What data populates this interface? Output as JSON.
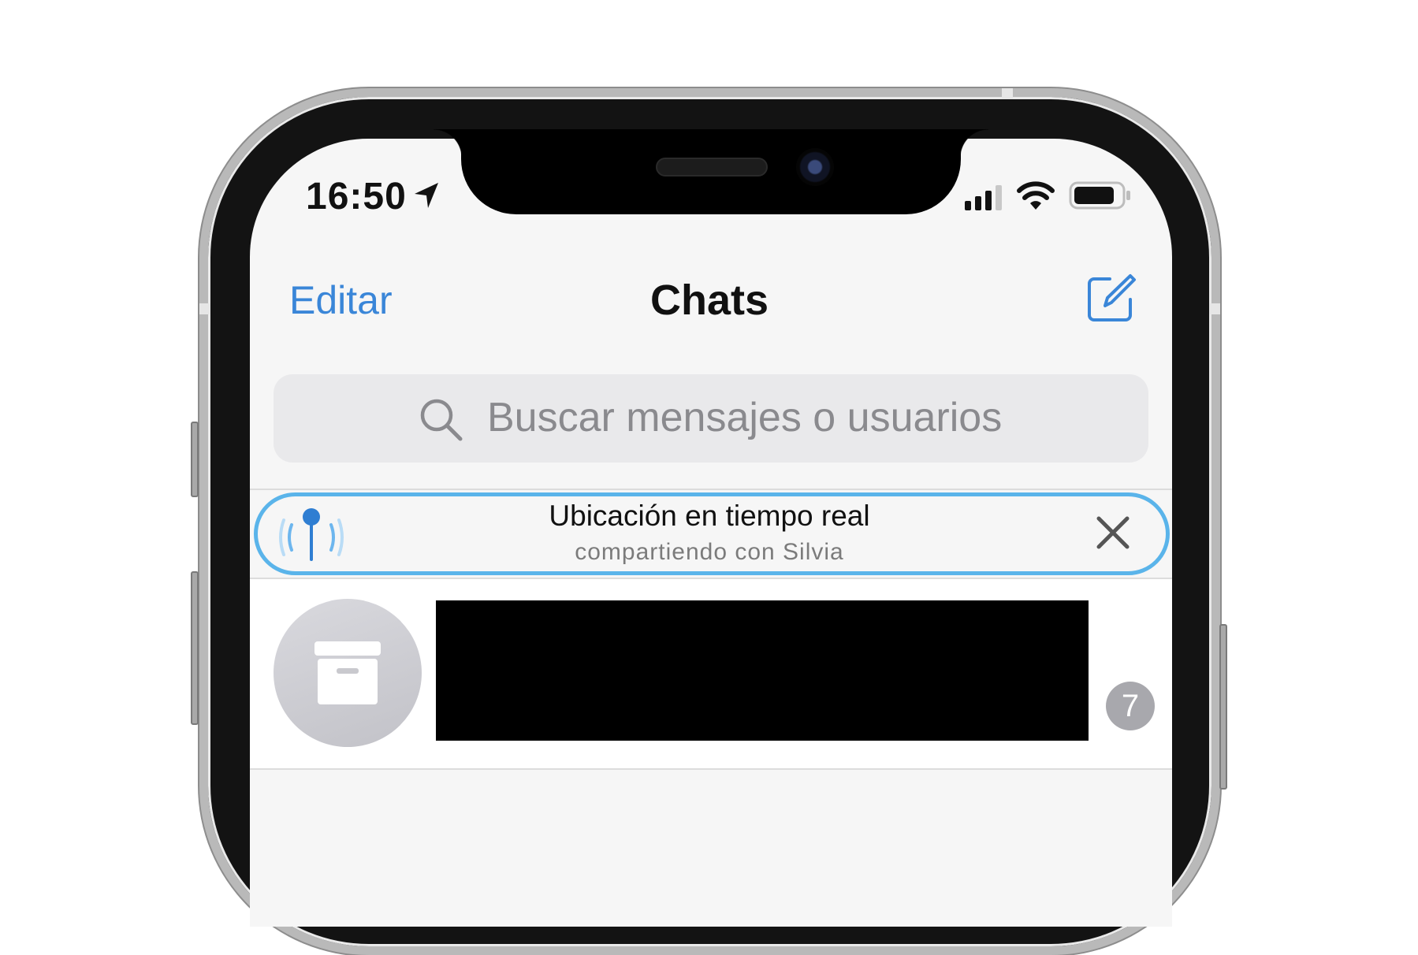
{
  "status_bar": {
    "time": "16:50",
    "location_icon": "location-arrow-icon",
    "signal_icon": "cellular-signal-icon",
    "wifi_icon": "wifi-icon",
    "battery_icon": "battery-icon"
  },
  "nav": {
    "edit_label": "Editar",
    "title": "Chats",
    "compose_icon": "compose-icon"
  },
  "search": {
    "placeholder": "Buscar mensajes o usuarios"
  },
  "live_location": {
    "title": "Ubicación en tiempo real",
    "subtitle": "compartiendo con Silvia"
  },
  "archived": {
    "unread_count": "7"
  },
  "colors": {
    "accent": "#3a86d8",
    "live_border": "#5ab4ea",
    "badge": "#a8a8ad"
  }
}
